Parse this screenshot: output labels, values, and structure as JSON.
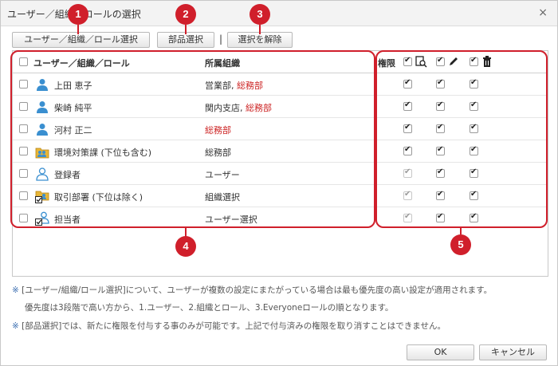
{
  "window": {
    "title": "ユーザー／組織／ロールの選択",
    "close_label": "×"
  },
  "toolbar": {
    "user_org_role_select": "ユーザー／組織／ロール選択",
    "dept_select": "部品選択",
    "separator": "|",
    "clear_selection": "選択を解除"
  },
  "header": {
    "name_label": "ユーザー／組織／ロール",
    "org_label": "所属組織",
    "perm_label": "権限"
  },
  "rows": [
    {
      "name": "上田 恵子",
      "org_main": "営業部,",
      "org_red": "総務部",
      "icon": "user-icon",
      "disabled": false
    },
    {
      "name": "柴崎 純平",
      "org_main": "関内支店,",
      "org_red": "総務部",
      "icon": "user-icon",
      "disabled": false
    },
    {
      "name": "河村 正二",
      "org_main": "",
      "org_red": "総務部",
      "icon": "user-icon",
      "disabled": false
    },
    {
      "name": "環境対策課 (下位も含む)",
      "org_main": "総務部",
      "org_red": "",
      "icon": "group-folder-icon",
      "disabled": false
    },
    {
      "name": "登録者",
      "org_main": "ユーザー",
      "org_red": "",
      "icon": "user-outline-icon",
      "disabled": true
    },
    {
      "name": "取引部署 (下位は除く)",
      "org_main": "組織選択",
      "org_red": "",
      "icon": "group-folder-check-icon",
      "disabled": true
    },
    {
      "name": "担当者",
      "org_main": "ユーザー選択",
      "org_red": "",
      "icon": "user-outline-check-icon",
      "disabled": true
    }
  ],
  "badges": [
    "1",
    "2",
    "3",
    "4",
    "5"
  ],
  "notes": {
    "note1_mark": "※",
    "note1_line1": "[ユーザー/組織/ロール選択]について、ユーザーが複数の設定にまたがっている場合は最も優先度の高い設定が適用されます。",
    "note1_line2": "優先度は3段階で高い方から、1.ユーザー、2.組織とロール、3.Everyoneロールの順となります。",
    "note2_mark": "※",
    "note2_line1": "[部品選択]では、新たに権限を付与する事のみが可能です。上記で付与済みの権限を取り消すことはできません。"
  },
  "footer": {
    "ok": "OK",
    "cancel": "キャンセル"
  },
  "colors": {
    "accent": "#d01f2b",
    "org_red": "#cc2222",
    "user_icon": "#3a8fd0"
  }
}
